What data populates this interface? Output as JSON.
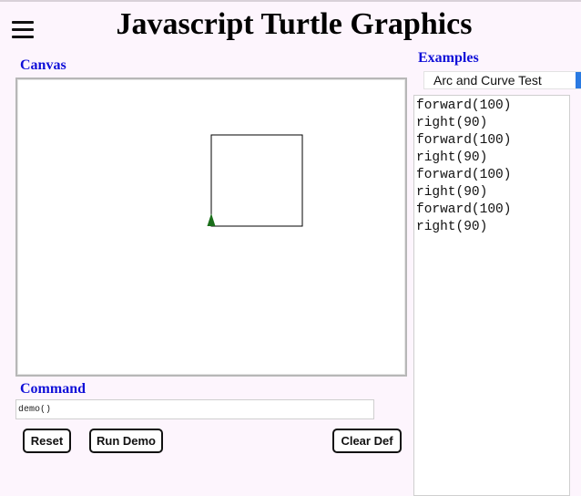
{
  "header": {
    "title": "Javascript Turtle Graphics"
  },
  "canvas_section": {
    "label": "Canvas",
    "drawing": {
      "square_side": 100,
      "turtle_color": "#1a6e1a",
      "stroke_color": "#000000"
    }
  },
  "command_section": {
    "label": "Command",
    "input_value": "demo()"
  },
  "buttons": {
    "reset_label": "Reset",
    "run_demo_label": "Run Demo",
    "clear_def_label": "Clear Def"
  },
  "examples_section": {
    "label": "Examples",
    "selected_example": "Arc and Curve Test"
  },
  "definitions": {
    "lines": [
      "forward(100)",
      "right(90)",
      "forward(100)",
      "right(90)",
      "forward(100)",
      "right(90)",
      "forward(100)",
      "right(90)"
    ]
  },
  "colors": {
    "background": "#fdf5fd",
    "label_blue": "#1010d8",
    "select_accent": "#2a7ae2"
  }
}
